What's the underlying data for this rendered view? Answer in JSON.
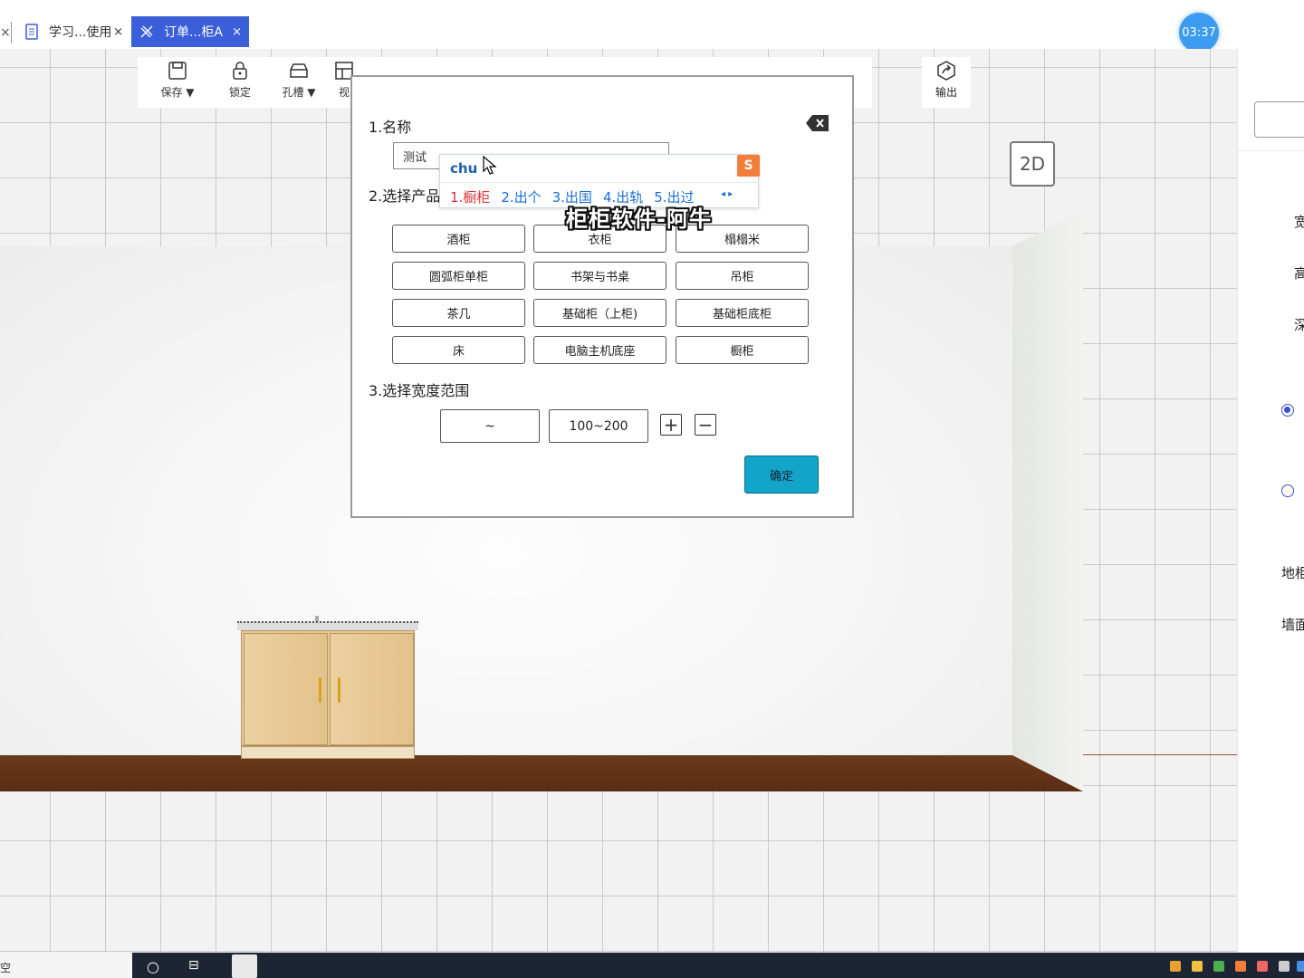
{
  "tabs": {
    "left_close": "×",
    "items": [
      {
        "label": "学习...使用",
        "close": "×",
        "active": false
      },
      {
        "label": "订单...柜A",
        "close": "×",
        "active": true
      }
    ]
  },
  "timer": "03:37",
  "toolbar": {
    "items": [
      {
        "label": "保存",
        "icon": "save-icon",
        "dropdown": true
      },
      {
        "label": "锁定",
        "icon": "lock-icon",
        "dropdown": false
      },
      {
        "label": "孔槽",
        "icon": "slot-icon",
        "dropdown": true
      },
      {
        "label": "视",
        "icon": "view-icon",
        "dropdown": false
      }
    ],
    "export_label": "输出",
    "view_mode_label": "2D"
  },
  "dialog": {
    "section_name": "1.名称",
    "name_value": "测试",
    "section_product": "2.选择产品",
    "products": [
      "酒柜",
      "衣柜",
      "榻榻米",
      "圆弧柜单柜",
      "书架与书桌",
      "吊柜",
      "茶几",
      "基础柜（上柜)",
      "基础柜底柜",
      "床",
      "电脑主机底座",
      "橱柜"
    ],
    "section_width": "3.选择宽度范围",
    "range_values": [
      "~",
      "100~200"
    ],
    "add_symbol": "+",
    "remove_symbol": "−",
    "confirm_label": "确定"
  },
  "ime": {
    "pinyin": "chu",
    "logo": "S",
    "candidates": [
      "1.橱柜",
      "2.出个",
      "3.出国",
      "4.出轨",
      "5.出过"
    ],
    "arrows": "◂ ▸"
  },
  "watermark": "柜柜软件-阿牛",
  "right_panel": {
    "labels": [
      "宽",
      "高",
      "深"
    ],
    "bottom_labels": [
      "地柜",
      "墙面"
    ],
    "radio_selected": 0
  },
  "taskbar": {
    "left_text": "空"
  },
  "colors": {
    "active_tab": "#3a5fd9",
    "confirm_button": "#12a4c9",
    "timer": "#3d9bef",
    "floor": "#5a2c12",
    "ime_first": "#e0343a",
    "ime_text": "#1a6fd0"
  }
}
